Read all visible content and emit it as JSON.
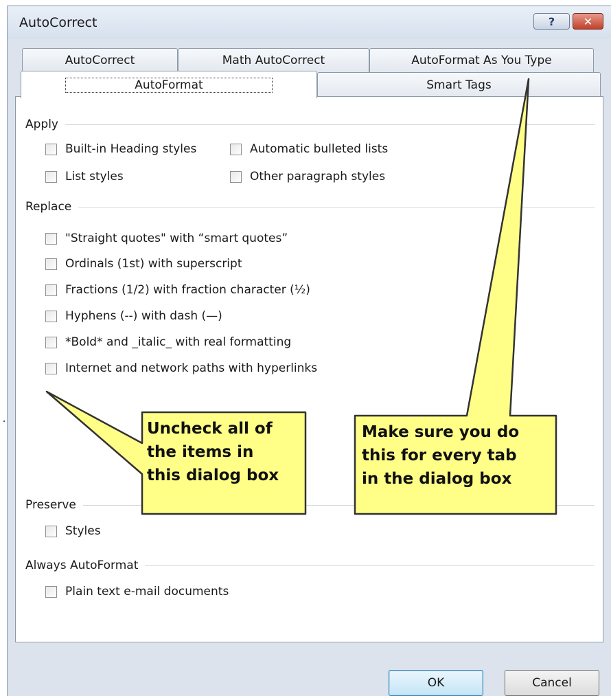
{
  "window": {
    "title": "AutoCorrect",
    "help_glyph": "?",
    "close_glyph": "✕"
  },
  "tabs_row1": [
    "AutoCorrect",
    "Math AutoCorrect",
    "AutoFormat As You Type"
  ],
  "tabs_row2": {
    "active": "AutoFormat",
    "other": "Smart Tags"
  },
  "groups": {
    "apply": {
      "label": "Apply",
      "items": [
        "Built-in Heading styles",
        "Automatic bulleted lists",
        "List styles",
        "Other paragraph styles"
      ]
    },
    "replace": {
      "label": "Replace",
      "items": [
        "\"Straight quotes\" with “smart quotes”",
        "Ordinals (1st) with superscript",
        "Fractions (1/2) with fraction character (½)",
        "Hyphens (--) with dash (—)",
        "*Bold* and _italic_ with real formatting",
        "Internet and network paths with hyperlinks"
      ]
    },
    "preserve": {
      "label": "Preserve",
      "items": [
        "Styles"
      ]
    },
    "always": {
      "label": "Always AutoFormat",
      "items": [
        "Plain text e-mail documents"
      ]
    }
  },
  "checked": false,
  "buttons": {
    "ok": "OK",
    "cancel": "Cancel"
  },
  "callouts": {
    "left": [
      "Uncheck all of",
      "the items in",
      "this dialog box"
    ],
    "right": [
      "Make sure you do",
      "this for every tab",
      "in the dialog box"
    ]
  },
  "colors": {
    "callout_fill": "#ffff88",
    "callout_border": "#333333"
  }
}
